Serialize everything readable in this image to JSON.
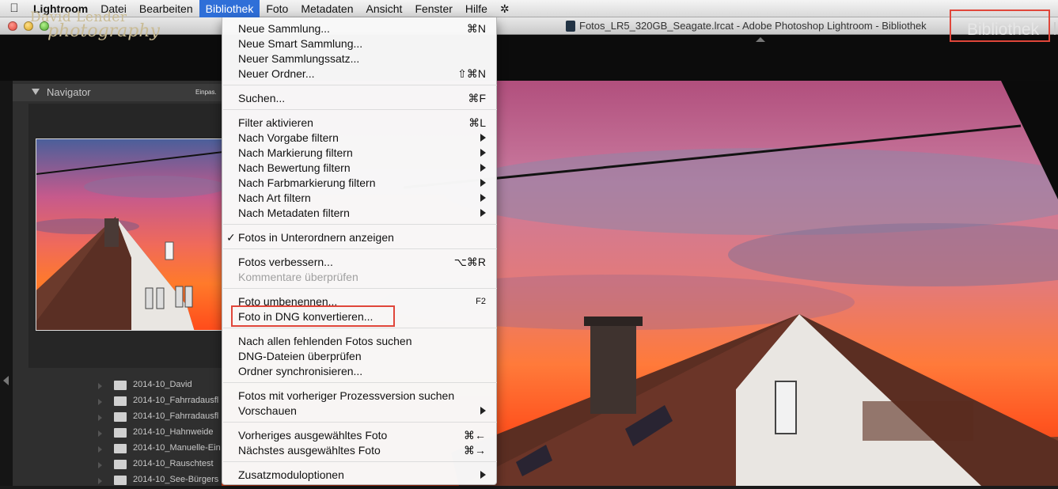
{
  "menubar": {
    "apple": "",
    "items": [
      "Lightroom",
      "Datei",
      "Bearbeiten",
      "Bibliothek",
      "Foto",
      "Metadaten",
      "Ansicht",
      "Fenster",
      "Hilfe",
      "✲"
    ]
  },
  "window": {
    "title": "Fotos_LR5_320GB_Seagate.lrcat - Adobe Photoshop Lightroom - Bibliothek"
  },
  "identity_plate": {
    "line1": "David Lender",
    "line2": "photography"
  },
  "module": {
    "active": "Bibliothek"
  },
  "navigator": {
    "title": "Navigator",
    "fit_label": "Einpas."
  },
  "folders": [
    {
      "name": "2014-10_David"
    },
    {
      "name": "2014-10_Fahrradausfl"
    },
    {
      "name": "2014-10_Fahrradausfl"
    },
    {
      "name": "2014-10_Hahnweide"
    },
    {
      "name": "2014-10_Manuelle-Ein"
    },
    {
      "name": "2014-10_Rauschtest"
    },
    {
      "name": "2014-10_See-Bürgers"
    }
  ],
  "menu": {
    "groups": [
      {
        "items": [
          {
            "label": "Neue Sammlung...",
            "shortcut": "⌘N",
            "submenu": false
          },
          {
            "label": "Neue Smart Sammlung...",
            "shortcut": "",
            "submenu": false
          },
          {
            "label": "Neuer Sammlungssatz...",
            "shortcut": "",
            "submenu": false
          },
          {
            "label": "Neuer Ordner...",
            "shortcut": "⇧⌘N",
            "submenu": false
          }
        ]
      },
      {
        "items": [
          {
            "label": "Suchen...",
            "shortcut": "⌘F",
            "submenu": false
          }
        ]
      },
      {
        "items": [
          {
            "label": "Filter aktivieren",
            "shortcut": "⌘L",
            "submenu": false
          },
          {
            "label": "Nach Vorgabe filtern",
            "shortcut": "",
            "submenu": true
          },
          {
            "label": "Nach Markierung filtern",
            "shortcut": "",
            "submenu": true
          },
          {
            "label": "Nach Bewertung filtern",
            "shortcut": "",
            "submenu": true
          },
          {
            "label": "Nach Farbmarkierung filtern",
            "shortcut": "",
            "submenu": true
          },
          {
            "label": "Nach Art filtern",
            "shortcut": "",
            "submenu": true
          },
          {
            "label": "Nach Metadaten filtern",
            "shortcut": "",
            "submenu": true
          }
        ]
      },
      {
        "items": [
          {
            "label": "Fotos in Unterordnern anzeigen",
            "shortcut": "",
            "submenu": false,
            "checked": true
          }
        ]
      },
      {
        "items": [
          {
            "label": "Fotos verbessern...",
            "shortcut": "⌥⌘R",
            "submenu": false
          },
          {
            "label": "Kommentare überprüfen",
            "shortcut": "",
            "submenu": false,
            "disabled": true
          }
        ]
      },
      {
        "items": [
          {
            "label": "Foto umbenennen...",
            "shortcut": "F2",
            "submenu": false
          },
          {
            "label": "Foto in DNG konvertieren...",
            "shortcut": "",
            "submenu": false,
            "highlighted": true
          }
        ]
      },
      {
        "items": [
          {
            "label": "Nach allen fehlenden Fotos suchen",
            "shortcut": "",
            "submenu": false
          },
          {
            "label": "DNG-Dateien überprüfen",
            "shortcut": "",
            "submenu": false
          },
          {
            "label": "Ordner synchronisieren...",
            "shortcut": "",
            "submenu": false
          }
        ]
      },
      {
        "items": [
          {
            "label": "Fotos mit vorheriger Prozessversion suchen",
            "shortcut": "",
            "submenu": false
          },
          {
            "label": "Vorschauen",
            "shortcut": "",
            "submenu": true
          }
        ]
      },
      {
        "items": [
          {
            "label": "Vorheriges ausgewähltes Foto",
            "shortcut": "⌘←",
            "submenu": false
          },
          {
            "label": "Nächstes ausgewähltes Foto",
            "shortcut": "⌘→",
            "submenu": false
          }
        ]
      },
      {
        "items": [
          {
            "label": "Zusatzmoduloptionen",
            "shortcut": "",
            "submenu": true
          }
        ]
      }
    ]
  },
  "colors": {
    "menu_active": "#2f6fd8",
    "highlight_border": "#e0463a",
    "identity_plate": "#c9bb94"
  },
  "icons": {
    "apple": "apple-icon",
    "script": "script-icon",
    "document": "lrcat-document-icon"
  }
}
